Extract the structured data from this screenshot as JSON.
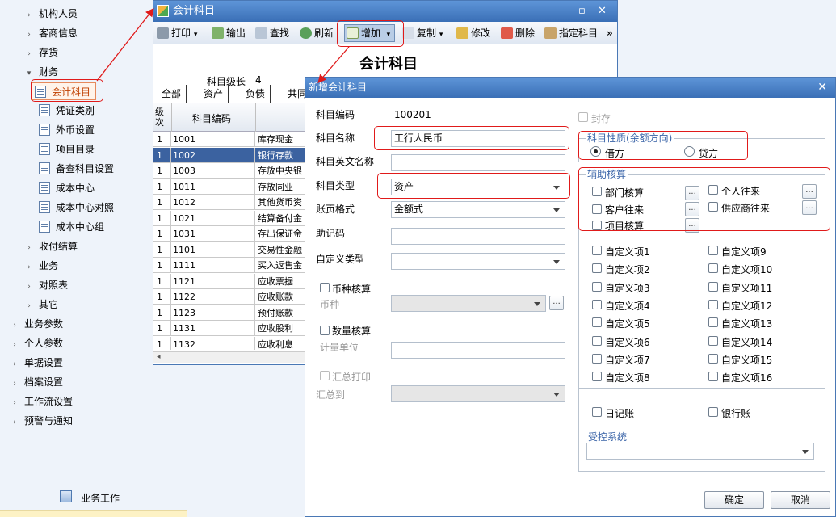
{
  "nav": {
    "items": [
      {
        "label": "机构人员",
        "type": "collapsed"
      },
      {
        "label": "客商信息",
        "type": "collapsed"
      },
      {
        "label": "存货",
        "type": "collapsed"
      },
      {
        "label": "财务",
        "type": "expanded"
      },
      {
        "label": "会计科目",
        "type": "leaf",
        "selected": true
      },
      {
        "label": "凭证类别",
        "type": "leaf"
      },
      {
        "label": "外币设置",
        "type": "leaf"
      },
      {
        "label": "项目目录",
        "type": "leaf"
      },
      {
        "label": "备查科目设置",
        "type": "leaf"
      },
      {
        "label": "成本中心",
        "type": "leaf"
      },
      {
        "label": "成本中心对照",
        "type": "leaf"
      },
      {
        "label": "成本中心组",
        "type": "leaf"
      },
      {
        "label": "收付结算",
        "type": "collapsed"
      },
      {
        "label": "业务",
        "type": "collapsed"
      },
      {
        "label": "对照表",
        "type": "collapsed"
      },
      {
        "label": "其它",
        "type": "collapsed"
      },
      {
        "label": "业务参数",
        "type": "collapsed"
      },
      {
        "label": "个人参数",
        "type": "collapsed"
      },
      {
        "label": "单据设置",
        "type": "collapsed"
      },
      {
        "label": "档案设置",
        "type": "collapsed"
      },
      {
        "label": "工作流设置",
        "type": "collapsed"
      },
      {
        "label": "预警与通知",
        "type": "collapsed"
      }
    ],
    "footer_label": "业务工作"
  },
  "accounts_window": {
    "title": "会计科目",
    "toolbar": {
      "print": "打印",
      "export": "输出",
      "find": "查找",
      "refresh": "刷新",
      "add": "增加",
      "copy": "复制",
      "edit": "修改",
      "delete": "删除",
      "assign": "指定科目",
      "more": "»"
    },
    "heading": "会计科目",
    "level_label": "科目级长",
    "level_value": "4",
    "tabs": [
      "全部",
      "资产",
      "负债",
      "共同"
    ],
    "grid_headers": {
      "level": "级次",
      "code": "科目编码"
    },
    "rows": [
      {
        "level": "1",
        "code": "1001",
        "name": "库存现金",
        "selected": false
      },
      {
        "level": "1",
        "code": "1002",
        "name": "银行存款",
        "selected": true
      },
      {
        "level": "1",
        "code": "1003",
        "name": "存放中央银",
        "selected": false
      },
      {
        "level": "1",
        "code": "1011",
        "name": "存放同业",
        "selected": false
      },
      {
        "level": "1",
        "code": "1012",
        "name": "其他货币资",
        "selected": false
      },
      {
        "level": "1",
        "code": "1021",
        "name": "结算备付金",
        "selected": false
      },
      {
        "level": "1",
        "code": "1031",
        "name": "存出保证金",
        "selected": false
      },
      {
        "level": "1",
        "code": "1101",
        "name": "交易性金融",
        "selected": false
      },
      {
        "level": "1",
        "code": "1111",
        "name": "买入返售金",
        "selected": false
      },
      {
        "level": "1",
        "code": "1121",
        "name": "应收票据",
        "selected": false
      },
      {
        "level": "1",
        "code": "1122",
        "name": "应收账款",
        "selected": false
      },
      {
        "level": "1",
        "code": "1123",
        "name": "预付账款",
        "selected": false
      },
      {
        "level": "1",
        "code": "1131",
        "name": "应收股利",
        "selected": false
      },
      {
        "level": "1",
        "code": "1132",
        "name": "应收利息",
        "selected": false
      }
    ]
  },
  "dialog": {
    "title": "新增会计科目",
    "fields": {
      "code_label": "科目编码",
      "code_value": "100201",
      "name_label": "科目名称",
      "name_value": "工行人民币",
      "en_name_label": "科目英文名称",
      "en_name_value": "",
      "type_label": "科目类型",
      "type_value": "资产",
      "format_label": "账页格式",
      "format_value": "金额式",
      "mnemonic_label": "助记码",
      "custom_type_label": "自定义类型",
      "currency_check_label": "币种核算",
      "currency_label": "币种",
      "qty_check_label": "数量核算",
      "unit_label": "计量单位",
      "summary_print_label": "汇总打印",
      "summary_to_label": "汇总到"
    },
    "sealed_label": "封存",
    "nature": {
      "title": "科目性质(余额方向)",
      "debit": "借方",
      "credit": "贷方",
      "selected": "借方"
    },
    "aux": {
      "title": "辅助核算",
      "dept": "部门核算",
      "person": "个人往来",
      "customer": "客户往来",
      "supplier": "供应商往来",
      "project": "项目核算",
      "ellipsis": "..."
    },
    "custom_items": [
      "自定义项1",
      "自定义项2",
      "自定义项3",
      "自定义项4",
      "自定义项5",
      "自定义项6",
      "自定义项7",
      "自定义项8",
      "自定义项9",
      "自定义项10",
      "自定义项11",
      "自定义项12",
      "自定义项13",
      "自定义项14",
      "自定义项15",
      "自定义项16"
    ],
    "journal_label": "日记账",
    "bank_journal_label": "银行账",
    "controlled_title": "受控系统",
    "ok": "确定",
    "cancel": "取消"
  },
  "colors": {
    "title_bar": "#3a6fb6",
    "selected_row": "#3b62a0",
    "highlight": "#e01a1a",
    "group_title": "#3a64a8"
  }
}
